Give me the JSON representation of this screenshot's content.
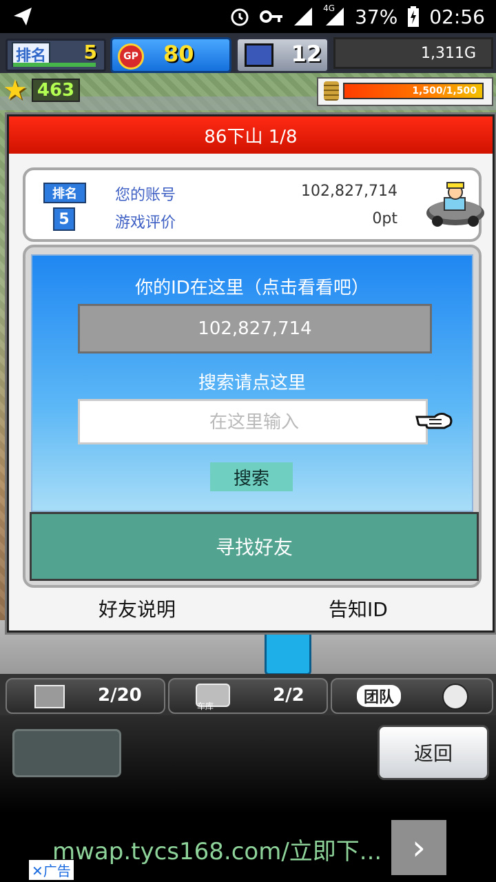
{
  "status_bar": {
    "battery": "37%",
    "time": "02:56",
    "network": "4G"
  },
  "hud": {
    "rank_label": "排名",
    "rank_value": "5",
    "gp_label": "GP",
    "gp_value": "80",
    "pc_value": "12",
    "money": "1,311G",
    "stars": "463",
    "energy": "1,500/1,500"
  },
  "dialog": {
    "title": "86下山 1/8",
    "rank_label": "排名",
    "rank_value": "5",
    "account_label": "您的账号",
    "account_value": "102,827,714",
    "rating_label": "游戏评价",
    "rating_value": "0pt",
    "id_prompt": "你的ID在这里（点击看看吧）",
    "id_value": "102,827,714",
    "search_hint": "搜索请点这里",
    "search_placeholder": "在这里输入",
    "search_button": "搜索",
    "find_friends": "寻找好友",
    "friend_info": "好友说明",
    "notify_id": "告知ID"
  },
  "tabs": {
    "items_count": "2/20",
    "garage_label": "车库",
    "garage_count": "2/2",
    "team_label": "团队"
  },
  "bottom": {
    "return_label": "返回"
  },
  "ad": {
    "text": "mwap.tycs168.com/立即下...",
    "badge": "✕广告",
    "arrow": "›"
  }
}
